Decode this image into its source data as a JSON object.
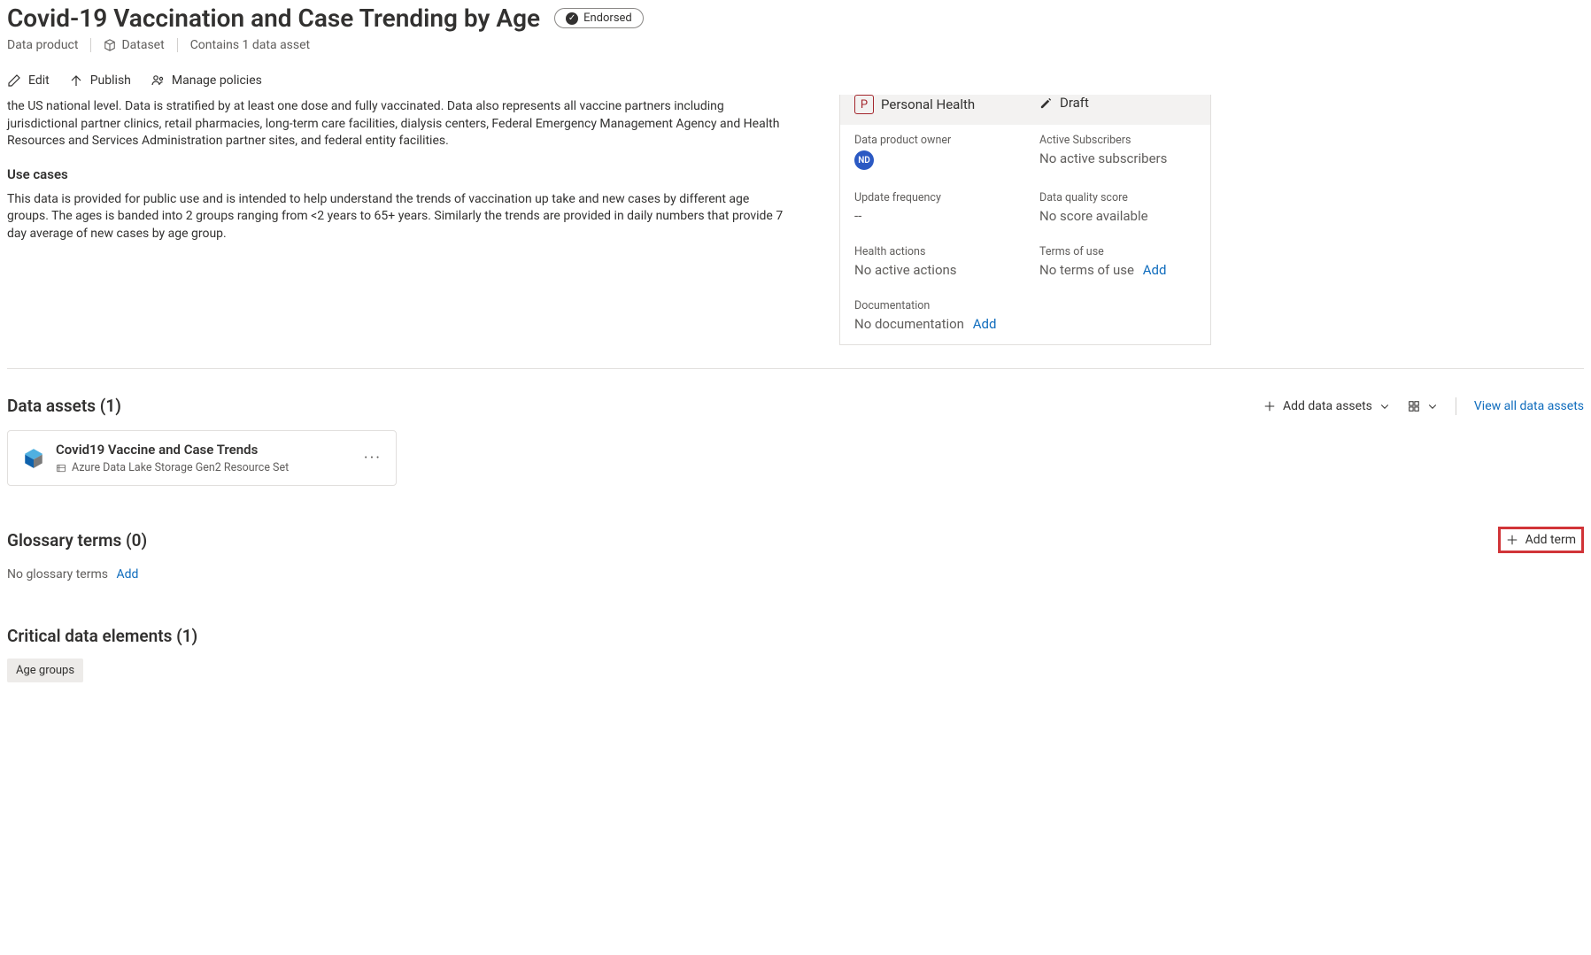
{
  "header": {
    "title": "Covid-19 Vaccination and Case Trending by Age",
    "endorsed_label": "Endorsed",
    "meta": {
      "data_product": "Data product",
      "dataset": "Dataset",
      "contains": "Contains 1 data asset"
    }
  },
  "toolbar": {
    "edit": "Edit",
    "publish": "Publish",
    "manage_policies": "Manage policies"
  },
  "description": {
    "paragraph1": "the US national level. Data is stratified by at least one dose and fully vaccinated. Data also represents all vaccine partners including jurisdictional partner clinics, retail pharmacies, long-term care facilities, dialysis centers, Federal Emergency Management Agency and Health Resources and Services Administration partner sites, and federal entity facilities.",
    "usecases_heading": "Use cases",
    "paragraph2": "This data is provided for public use and is intended to help understand the trends of vaccination up take and new cases by different age groups.  The ages is banded into 2 groups ranging from <2 years to 65+ years.  Similarly the trends are provided in daily numbers that provide 7 day average of new cases by age group."
  },
  "side": {
    "domain_value": "Personal Health",
    "domain_letter": "P",
    "status_value": "Draft",
    "owner_label": "Data product owner",
    "owner_initials": "ND",
    "subscribers_label": "Active Subscribers",
    "subscribers_value": "No active subscribers",
    "update_label": "Update frequency",
    "update_value": "--",
    "quality_label": "Data quality score",
    "quality_value": "No score available",
    "health_label": "Health actions",
    "health_value": "No active actions",
    "terms_label": "Terms of use",
    "terms_value": "No terms of use",
    "terms_add": "Add",
    "doc_label": "Documentation",
    "doc_value": "No documentation",
    "doc_add": "Add"
  },
  "assets": {
    "heading": "Data assets (1)",
    "add_label": "Add data assets",
    "viewall": "View all data assets",
    "card": {
      "title": "Covid19 Vaccine and Case Trends",
      "subtitle": "Azure Data Lake Storage Gen2 Resource Set"
    }
  },
  "glossary": {
    "heading": "Glossary terms (0)",
    "addterm": "Add term",
    "empty": "No glossary terms",
    "add_link": "Add"
  },
  "cde": {
    "heading": "Critical data elements (1)",
    "tag": "Age groups"
  }
}
